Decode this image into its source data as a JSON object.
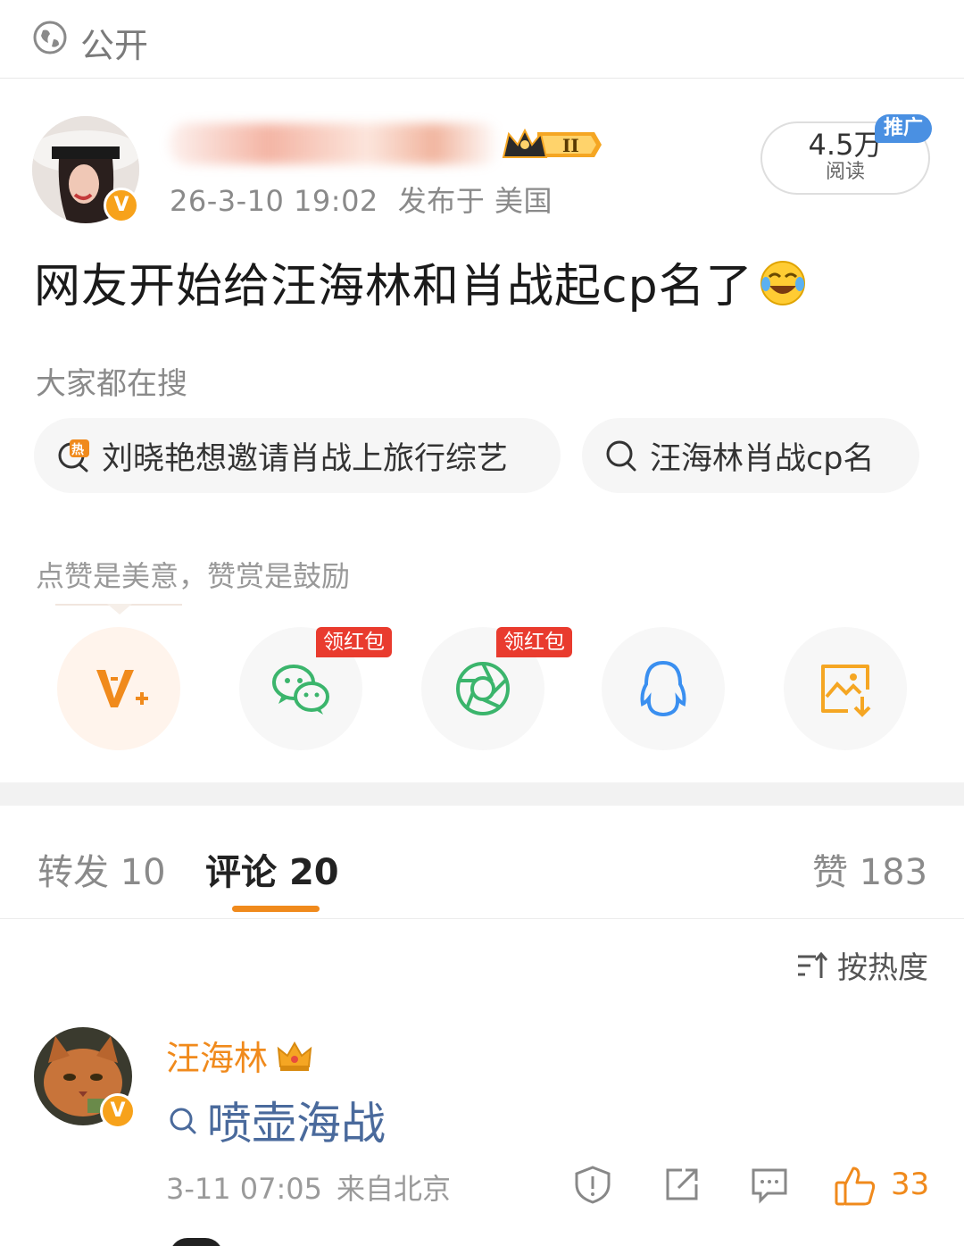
{
  "visibility": {
    "label": "公开",
    "icon": "globe-icon"
  },
  "post": {
    "time": "26-3-10 19:02",
    "location": "发布于 美国",
    "reads": "4.5万",
    "reads_label": "阅读",
    "promo_tag": "推广",
    "text": "网友开始给汪海林和肖战起cp名了"
  },
  "search": {
    "title": "大家都在搜",
    "items": [
      {
        "label": "刘晓艳想邀请肖战上旅行综艺",
        "icon": "hot-search-icon"
      },
      {
        "label": "汪海林肖战cp名",
        "icon": "search-icon"
      }
    ]
  },
  "praise": {
    "text": "点赞是美意，赞赏是鼓励",
    "share_items": [
      {
        "name": "weibo-reward",
        "badge": ""
      },
      {
        "name": "wechat",
        "badge": "领红包"
      },
      {
        "name": "moments",
        "badge": "领红包"
      },
      {
        "name": "qq",
        "badge": ""
      },
      {
        "name": "save-image",
        "badge": ""
      }
    ]
  },
  "tabs": {
    "repost_label": "转发",
    "repost_count": "10",
    "comment_label": "评论",
    "comment_count": "20",
    "like_label": "赞",
    "like_count": "183"
  },
  "sort": {
    "label": "按热度"
  },
  "comment": {
    "author": "汪海林",
    "text": "喷壶海战",
    "time": "3-11 07:05",
    "location": "来自北京",
    "likes": "33"
  },
  "colors": {
    "accent": "#f08a1c",
    "link": "#4a6a9c",
    "promo": "#4a90e2",
    "redpack": "#e93b2e"
  }
}
